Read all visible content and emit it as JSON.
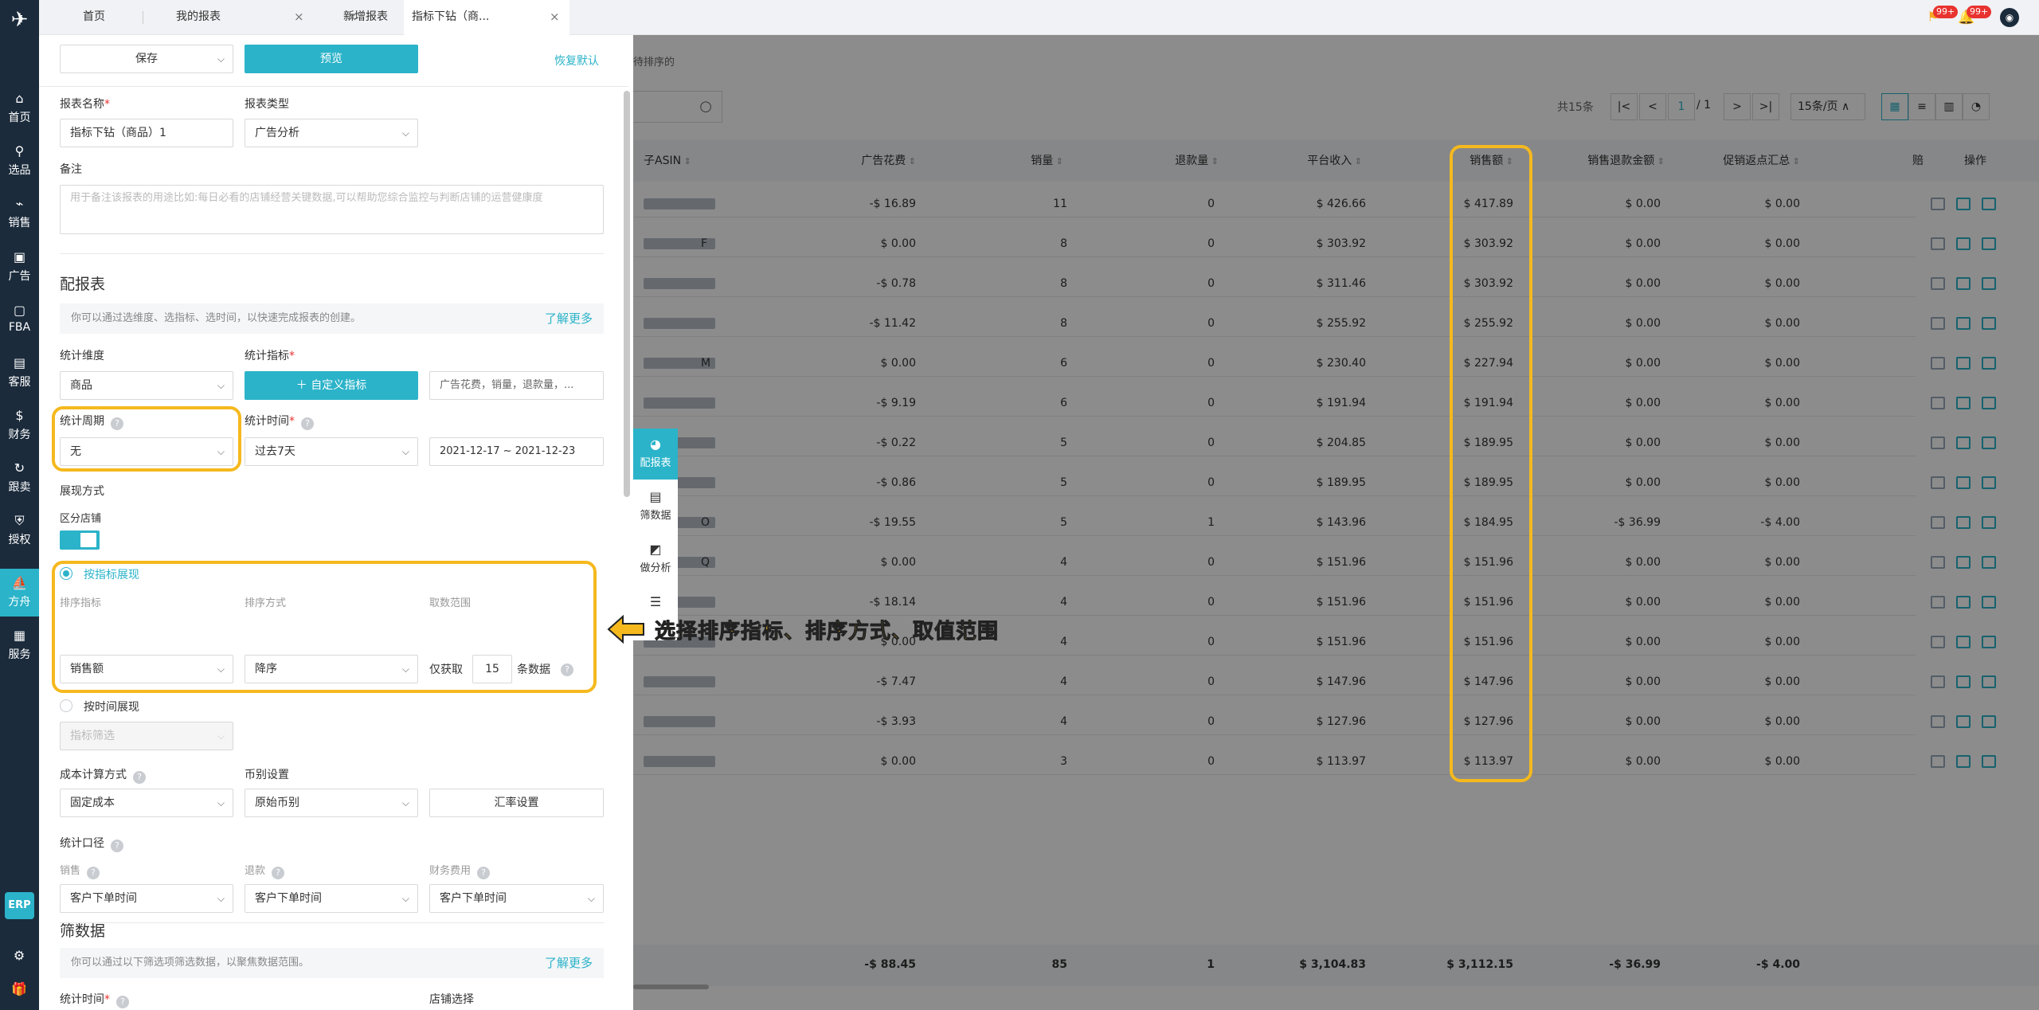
{
  "topbar": {
    "tabs": [
      {
        "label": "首页"
      },
      {
        "label": "我的报表"
      },
      {
        "label": "新增报表"
      },
      {
        "label": "指标下钻（商..."
      }
    ],
    "badges": [
      "99+",
      "99+"
    ]
  },
  "sidebar": {
    "items": [
      {
        "label": "首页",
        "icon": "home-icon"
      },
      {
        "label": "选品",
        "icon": "search-icon"
      },
      {
        "label": "销售",
        "icon": "chart-line-icon"
      },
      {
        "label": "广告",
        "icon": "ad-icon"
      },
      {
        "label": "FBA",
        "icon": "box-icon"
      },
      {
        "label": "客服",
        "icon": "chat-icon"
      },
      {
        "label": "财务",
        "icon": "dollar-icon"
      },
      {
        "label": "跟卖",
        "icon": "follow-icon"
      },
      {
        "label": "授权",
        "icon": "shield-icon"
      },
      {
        "label": "方舟",
        "icon": "ark-icon"
      },
      {
        "label": "服务",
        "icon": "service-icon"
      }
    ],
    "erp": "ERP"
  },
  "panel": {
    "save_label": "保存",
    "preview_label": "预览",
    "reset_label": "恢复默认",
    "report_name_label": "报表名称",
    "report_name_value": "指标下钻（商品）1",
    "report_type_label": "报表类型",
    "report_type_value": "广告分析",
    "remark_label": "备注",
    "remark_placeholder": "用于备注该报表的用途比如:每日必看的店铺经营关键数据,可以帮助您综合监控与判断店铺的运营健康度",
    "config_title": "配报表",
    "config_info": "你可以通过选维度、选指标、选时间，以快速完成报表的创建。",
    "learn_more": "了解更多",
    "dimension_label": "统计维度",
    "dimension_value": "商品",
    "metrics_label": "统计指标",
    "custom_metric_btn": "自定义指标",
    "metrics_summary": "广告花费，销量，退款量，...",
    "period_label": "统计周期",
    "period_value": "无",
    "time_label": "统计时间",
    "time_value": "过去7天",
    "date_range": "2021-12-17 ~ 2021-12-23",
    "display_label": "展现方式",
    "by_store_label": "区分店铺",
    "by_metric_label": "按指标展现",
    "sort_metric_label": "排序指标",
    "sort_metric_value": "销售额",
    "sort_order_label": "排序方式",
    "sort_order_value": "降序",
    "range_label": "取数范围",
    "range_prefix": "仅获取",
    "range_value": "15",
    "range_suffix": "条数据",
    "by_time_label": "按时间展现",
    "metric_filter_placeholder": "指标筛选",
    "cost_label": "成本计算方式",
    "cost_value": "固定成本",
    "currency_label": "币别设置",
    "currency_value": "原始币别",
    "rate_btn": "汇率设置",
    "caliber_label": "统计口径",
    "sales_label": "销售",
    "refund_label": "退款",
    "finance_label": "财务费用",
    "caliber_sales": "客户下单时间",
    "caliber_refund": "客户下单时间",
    "caliber_finance": "客户下单时间",
    "filter_title": "筛数据",
    "filter_info": "你可以通过以下筛选项筛选数据，以聚焦数据范围。",
    "filter_time_label": "统计时间",
    "store_select_label": "店铺选择"
  },
  "float_tabs": [
    {
      "label": "配报表",
      "icon": "pie-icon"
    },
    {
      "label": "筛数据",
      "icon": "filter-chart-icon"
    },
    {
      "label": "做分析",
      "icon": "analysis-icon"
    },
    {
      "label": "",
      "icon": "list-icon"
    }
  ],
  "annotation": "选择排序指标、排序方式、取值范围",
  "table": {
    "breadcrumb_tail": "待排序的",
    "total": "共15条",
    "page_current": "1",
    "page_total": "/ 1",
    "page_size": "15条/页",
    "headers": [
      "子ASIN",
      "广告花费",
      "销量",
      "退款量",
      "平台收入",
      "销售额",
      "销售退款金额",
      "促销返点汇总",
      "赔",
      "操作"
    ],
    "rows": [
      {
        "ad": "-$ 16.89",
        "qty": "11",
        "refund": "0",
        "income": "$ 426.66",
        "sales": "$ 417.89",
        "sr": "$ 0.00",
        "promo": "$ 0.00",
        "asin_tail": ""
      },
      {
        "ad": "$ 0.00",
        "qty": "8",
        "refund": "0",
        "income": "$ 303.92",
        "sales": "$ 303.92",
        "sr": "$ 0.00",
        "promo": "$ 0.00",
        "asin_tail": "F"
      },
      {
        "ad": "-$ 0.78",
        "qty": "8",
        "refund": "0",
        "income": "$ 311.46",
        "sales": "$ 303.92",
        "sr": "$ 0.00",
        "promo": "$ 0.00",
        "asin_tail": ""
      },
      {
        "ad": "-$ 11.42",
        "qty": "8",
        "refund": "0",
        "income": "$ 255.92",
        "sales": "$ 255.92",
        "sr": "$ 0.00",
        "promo": "$ 0.00",
        "asin_tail": ""
      },
      {
        "ad": "$ 0.00",
        "qty": "6",
        "refund": "0",
        "income": "$ 230.40",
        "sales": "$ 227.94",
        "sr": "$ 0.00",
        "promo": "$ 0.00",
        "asin_tail": "M"
      },
      {
        "ad": "-$ 9.19",
        "qty": "6",
        "refund": "0",
        "income": "$ 191.94",
        "sales": "$ 191.94",
        "sr": "$ 0.00",
        "promo": "$ 0.00",
        "asin_tail": ""
      },
      {
        "ad": "-$ 0.22",
        "qty": "5",
        "refund": "0",
        "income": "$ 204.85",
        "sales": "$ 189.95",
        "sr": "$ 0.00",
        "promo": "$ 0.00",
        "asin_tail": ""
      },
      {
        "ad": "-$ 0.86",
        "qty": "5",
        "refund": "0",
        "income": "$ 189.95",
        "sales": "$ 189.95",
        "sr": "$ 0.00",
        "promo": "$ 0.00",
        "asin_tail": ""
      },
      {
        "ad": "-$ 19.55",
        "qty": "5",
        "refund": "1",
        "income": "$ 143.96",
        "sales": "$ 184.95",
        "sr": "-$ 36.99",
        "promo": "-$ 4.00",
        "asin_tail": "O"
      },
      {
        "ad": "$ 0.00",
        "qty": "4",
        "refund": "0",
        "income": "$ 151.96",
        "sales": "$ 151.96",
        "sr": "$ 0.00",
        "promo": "$ 0.00",
        "asin_tail": "Q"
      },
      {
        "ad": "-$ 18.14",
        "qty": "4",
        "refund": "0",
        "income": "$ 151.96",
        "sales": "$ 151.96",
        "sr": "$ 0.00",
        "promo": "$ 0.00",
        "asin_tail": ""
      },
      {
        "ad": "$ 0.00",
        "qty": "4",
        "refund": "0",
        "income": "$ 151.96",
        "sales": "$ 151.96",
        "sr": "$ 0.00",
        "promo": "$ 0.00",
        "asin_tail": ""
      },
      {
        "ad": "-$ 7.47",
        "qty": "4",
        "refund": "0",
        "income": "$ 147.96",
        "sales": "$ 147.96",
        "sr": "$ 0.00",
        "promo": "$ 0.00",
        "asin_tail": ""
      },
      {
        "ad": "-$ 3.93",
        "qty": "4",
        "refund": "0",
        "income": "$ 127.96",
        "sales": "$ 127.96",
        "sr": "$ 0.00",
        "promo": "$ 0.00",
        "asin_tail": ""
      },
      {
        "ad": "$ 0.00",
        "qty": "3",
        "refund": "0",
        "income": "$ 113.97",
        "sales": "$ 113.97",
        "sr": "$ 0.00",
        "promo": "$ 0.00",
        "asin_tail": ""
      }
    ],
    "totals": {
      "ad": "-$ 88.45",
      "qty": "85",
      "refund": "1",
      "income": "$ 3,104.83",
      "sales": "$ 3,112.15",
      "sr": "-$ 36.99",
      "promo": "-$ 4.00"
    }
  },
  "colors": {
    "accent": "#2bb3c9",
    "highlight": "#f5b91e",
    "sidebar": "#1b2b3c"
  }
}
